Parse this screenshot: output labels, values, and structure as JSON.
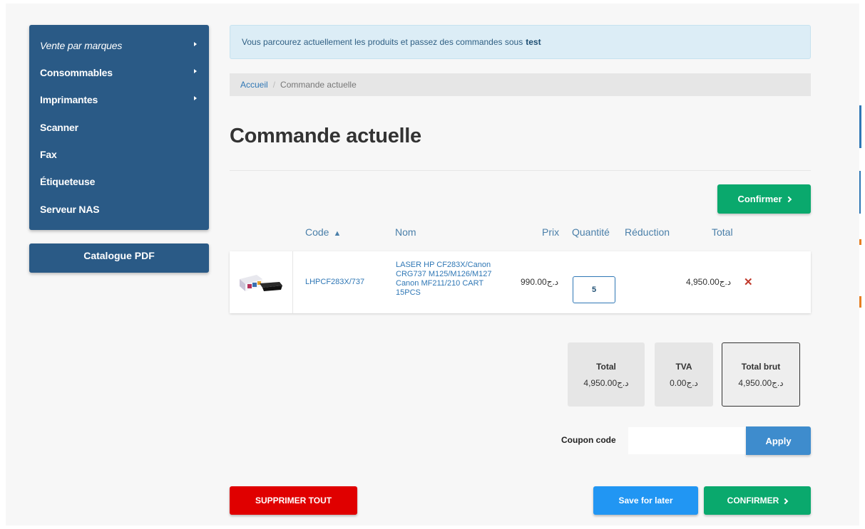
{
  "colors": {
    "sidebar": "#2a5a86",
    "accent_green": "#0aa96d",
    "link": "#2f77b5",
    "danger": "#e00000",
    "save": "#2196f3",
    "apply": "#3e8ccd"
  },
  "sidebar": {
    "items": [
      {
        "label": "Vente par marques",
        "has_submenu": true
      },
      {
        "label": "Consommables",
        "has_submenu": true
      },
      {
        "label": "Imprimantes",
        "has_submenu": true
      },
      {
        "label": "Scanner",
        "has_submenu": false
      },
      {
        "label": "Fax",
        "has_submenu": false
      },
      {
        "label": "Étiqueteuse",
        "has_submenu": false
      },
      {
        "label": "Serveur NAS",
        "has_submenu": false
      }
    ],
    "catalogue_label": "Catalogue PDF"
  },
  "notice": {
    "text": "Vous parcourez actuellement les produits et passez des commandes sous",
    "account": "test"
  },
  "breadcrumb": {
    "home": "Accueil",
    "separator": "/",
    "current": "Commande actuelle"
  },
  "page_title": "Commande actuelle",
  "confirm_top_label": "Confirmer",
  "table": {
    "headers": {
      "code": "Code",
      "sort_indicator": "▲",
      "nom": "Nom",
      "prix": "Prix",
      "quantite": "Quantité",
      "reduction": "Réduction",
      "total": "Total"
    },
    "rows": [
      {
        "code": "LHPCF283X/737",
        "name": "LASER HP CF283X/Canon CRG737 M125/M126/M127 Canon MF211/210 CART 15PCS",
        "price": "990.00د.ج",
        "quantity": "5",
        "total": "4,950.00د.ج"
      }
    ]
  },
  "summary": {
    "total_label": "Total",
    "total_value": "4,950.00د.ج",
    "tva_label": "TVA",
    "tva_value": "0.00د.ج",
    "brut_label": "Total brut",
    "brut_value": "4,950.00د.ج"
  },
  "coupon": {
    "label": "Coupon code",
    "value": "",
    "apply_label": "Apply"
  },
  "actions": {
    "delete_all": "SUPPRIMER TOUT",
    "save_for_later": "Save for later",
    "confirm": "CONFIRMER"
  }
}
